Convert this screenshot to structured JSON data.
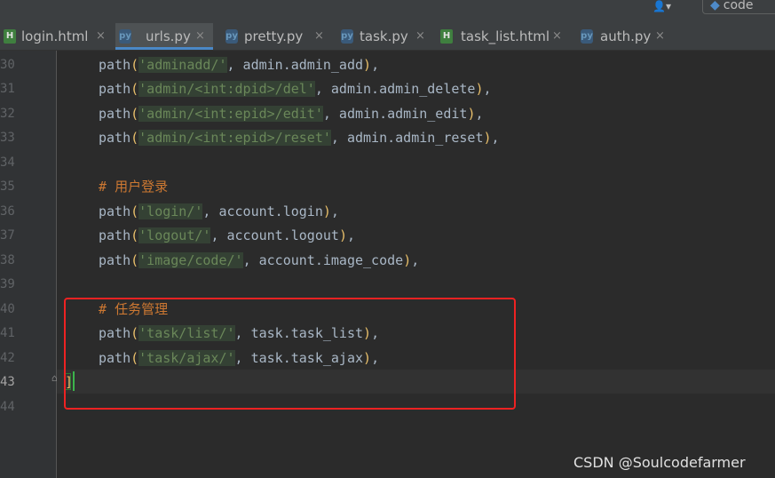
{
  "toolbar": {
    "user_icon_glyph": "👤▾",
    "run_config_label": "code"
  },
  "tabs": [
    {
      "label": "login.html",
      "icon": "html-file-icon",
      "icon_text": "H",
      "active": false
    },
    {
      "label": "urls.py",
      "icon": "python-file-icon",
      "icon_text": "py",
      "active": true
    },
    {
      "label": "pretty.py",
      "icon": "python-file-icon",
      "icon_text": "py",
      "active": false
    },
    {
      "label": "task.py",
      "icon": "python-file-icon",
      "icon_text": "py",
      "active": false
    },
    {
      "label": "task_list.html",
      "icon": "html-file-icon",
      "icon_text": "H",
      "active": false
    },
    {
      "label": "auth.py",
      "icon": "python-file-icon",
      "icon_text": "py",
      "active": false
    }
  ],
  "tab_close_glyph": "×",
  "line_numbers": [
    "30",
    "31",
    "32",
    "33",
    "34",
    "35",
    "36",
    "37",
    "38",
    "39",
    "40",
    "41",
    "42",
    "43",
    "44"
  ],
  "code": {
    "l30": {
      "fn": "path",
      "open": "(",
      "str": "'adminadd/'",
      "rest": ", admin.admin_add",
      "close": ")",
      "end": ","
    },
    "l31": {
      "fn": "path",
      "open": "(",
      "str": "'admin/<int:dpid>/del'",
      "rest": ", admin.admin_delete",
      "close": ")",
      "end": ","
    },
    "l32": {
      "fn": "path",
      "open": "(",
      "str": "'admin/<int:epid>/edit'",
      "rest": ", admin.admin_edit",
      "close": ")",
      "end": ","
    },
    "l33": {
      "fn": "path",
      "open": "(",
      "str": "'admin/<int:epid>/reset'",
      "rest": ", admin.admin_reset",
      "close": ")",
      "end": ","
    },
    "l35": {
      "hash": "# ",
      "text": "用户登录"
    },
    "l36": {
      "fn": "path",
      "open": "(",
      "str": "'login/'",
      "rest": ", account.login",
      "close": ")",
      "end": ","
    },
    "l37": {
      "fn": "path",
      "open": "(",
      "str": "'logout/'",
      "rest": ", account.logout",
      "close": ")",
      "end": ","
    },
    "l38": {
      "fn": "path",
      "open": "(",
      "str": "'image/code/'",
      "rest": ", account.image_code",
      "close": ")",
      "end": ","
    },
    "l40": {
      "hash": "# ",
      "text": "任务管理"
    },
    "l41": {
      "fn": "path",
      "open": "(",
      "str": "'task/list/'",
      "rest": ", task.task_list",
      "close": ")",
      "end": ","
    },
    "l42": {
      "fn": "path",
      "open": "(",
      "str": "'task/ajax/'",
      "rest": ", task.task_ajax",
      "close": ")",
      "end": ","
    },
    "l43": {
      "bracket": "]"
    }
  },
  "watermark": "CSDN @Soulcodefarmer",
  "colors": {
    "background": "#2b2b2b",
    "string": "#6a8759",
    "comment": "#cc7832",
    "paren": "#e8bf6a",
    "highlight_box": "#ee2222",
    "active_tab_underline": "#4a88c7"
  }
}
